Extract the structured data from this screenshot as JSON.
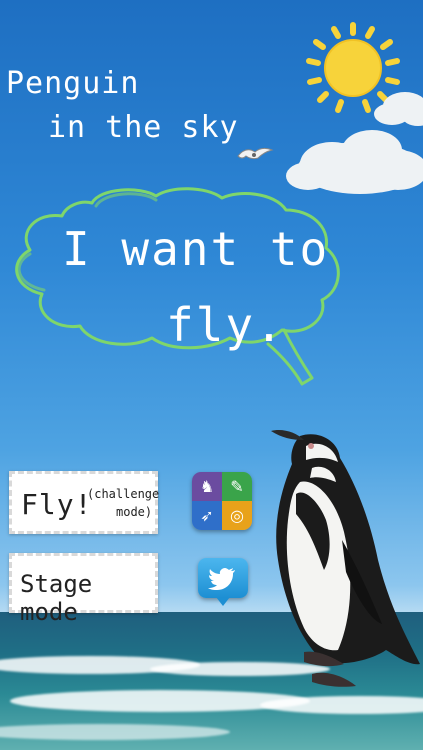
{
  "title": {
    "line1": "Penguin",
    "line2": "in the sky"
  },
  "speech": {
    "line1": "I want to",
    "line2": "fly."
  },
  "buttons": {
    "fly_main": "Fly!",
    "fly_sub_line1": "(challenge",
    "fly_sub_line2": "mode)",
    "stage": "Stage mode"
  },
  "icons": {
    "sun": "sun-icon",
    "game_center": "game-center-icon",
    "twitter": "twitter-icon"
  },
  "colors": {
    "sky_top": "#1e6fc2",
    "sun": "#f7d33a",
    "speech_outline": "#7fd66b",
    "game_center_tiles": [
      "#6b4ca0",
      "#3aa44a",
      "#2f6fc9",
      "#e8a21a"
    ],
    "twitter": "#1d8fd3"
  }
}
